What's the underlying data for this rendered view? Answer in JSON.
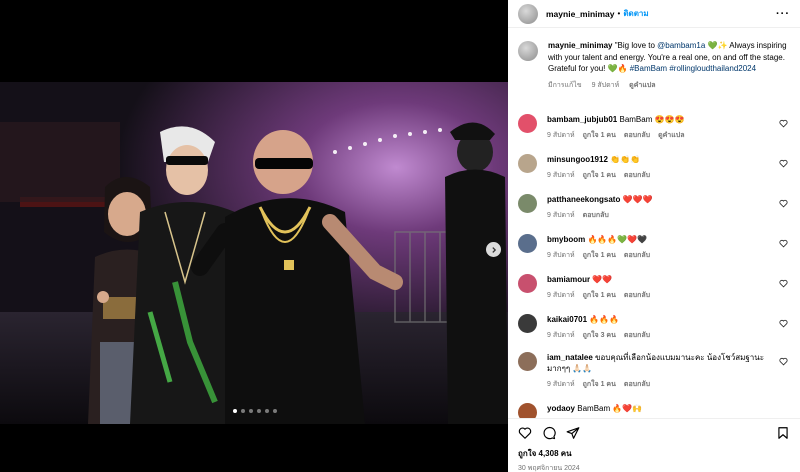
{
  "post": {
    "username": "maynie_minimay",
    "header_separator": "•",
    "follow_label": "ติดตาม",
    "more_label": "···",
    "caption_parts": {
      "lead": "\"Big love to ",
      "mention": "@bambam1a",
      "body": " 💚✨ Always inspiring with your talent and energy. You're a real one, on and off the stage. Grateful for you! 💚🔥 ",
      "tag1": "#BamBam",
      "tag2": "#rollingloudthailand2024"
    },
    "caption_meta": {
      "edited": "มีการแก้ไข",
      "time": "9 สัปดาห์",
      "translate": "ดูคำแปล"
    },
    "likes": "ถูกใจ 4,308 คน",
    "date": "30 พฤศจิกายน 2024"
  },
  "carousel": {
    "total": 6,
    "active": 1
  },
  "comments": [
    {
      "user": "bambam_jubjub01",
      "text": "BamBam 😍😍😍",
      "time": "9 สัปดาห์",
      "likes": "ถูกใจ 1 คน",
      "reply": "ตอบกลับ",
      "translate": "ดูคำแปล",
      "avatar_color": "#e2506a"
    },
    {
      "user": "minsungoo1912",
      "text": "👏👏👏",
      "time": "9 สัปดาห์",
      "likes": "ถูกใจ 1 คน",
      "reply": "ตอบกลับ",
      "translate": "",
      "avatar_color": "#b8a58c"
    },
    {
      "user": "patthaneekongsato",
      "text": "❤️❤️❤️",
      "time": "9 สัปดาห์",
      "likes": "",
      "reply": "ตอบกลับ",
      "translate": "",
      "avatar_color": "#7a8a6a"
    },
    {
      "user": "bmyboom",
      "text": "🔥🔥🔥💚❤️🖤",
      "time": "9 สัปดาห์",
      "likes": "ถูกใจ 1 คน",
      "reply": "ตอบกลับ",
      "translate": "",
      "avatar_color": "#5a6e8c"
    },
    {
      "user": "bamiamour",
      "text": "❤️❤️",
      "time": "9 สัปดาห์",
      "likes": "ถูกใจ 1 คน",
      "reply": "ตอบกลับ",
      "translate": "",
      "avatar_color": "#c8506e"
    },
    {
      "user": "kaikai0701",
      "text": "🔥🔥🔥",
      "time": "9 สัปดาห์",
      "likes": "ถูกใจ 3 คน",
      "reply": "ตอบกลับ",
      "translate": "",
      "avatar_color": "#3a3a3a"
    },
    {
      "user": "iam_natalee",
      "text": "ขอบคุณที่เลือกน้องแบมมานะคะ น้องโชว์สมฐานะมากๆๆ 🙏🏻🙏🏻",
      "time": "9 สัปดาห์",
      "likes": "ถูกใจ 1 คน",
      "reply": "ตอบกลับ",
      "translate": "",
      "avatar_color": "#8c6e5a"
    },
    {
      "user": "yodaoy",
      "text": "BamBam 🔥❤️🙌",
      "time": "",
      "likes": "",
      "reply": "",
      "translate": "",
      "avatar_color": "#a0522d"
    }
  ],
  "icons": {
    "like": "heart-icon",
    "comment": "comment-icon",
    "share": "send-icon",
    "save": "bookmark-icon",
    "next": "chevron-right-icon"
  },
  "colors": {
    "link": "#00376b",
    "follow": "#0095f6",
    "meta": "#737373"
  }
}
